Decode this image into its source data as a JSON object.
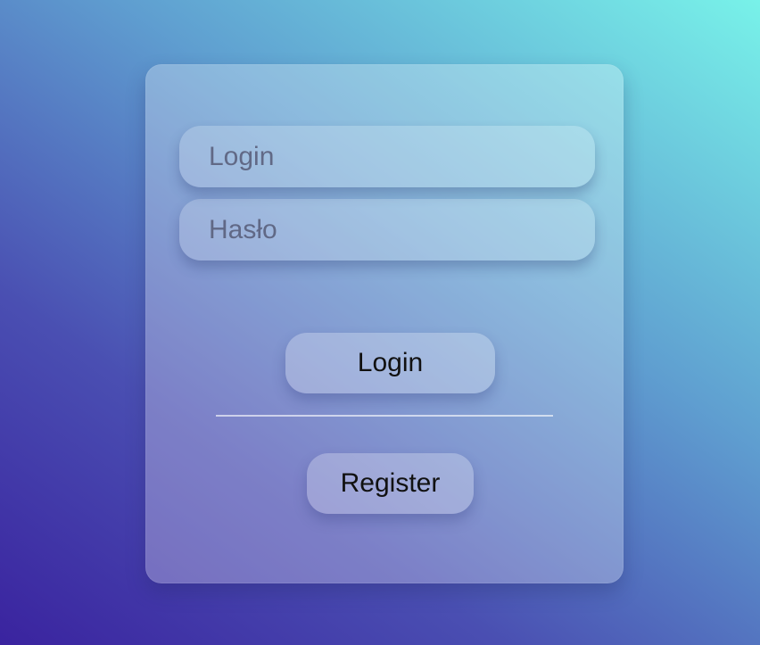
{
  "form": {
    "fields": {
      "login_placeholder": "Login",
      "password_placeholder": "Hasło"
    },
    "buttons": {
      "login": "Login",
      "register": "Register"
    }
  },
  "colors": {
    "background_start": "#3a239f",
    "background_end": "#78f2e9",
    "card": "#ffffff",
    "text": "#111111"
  }
}
